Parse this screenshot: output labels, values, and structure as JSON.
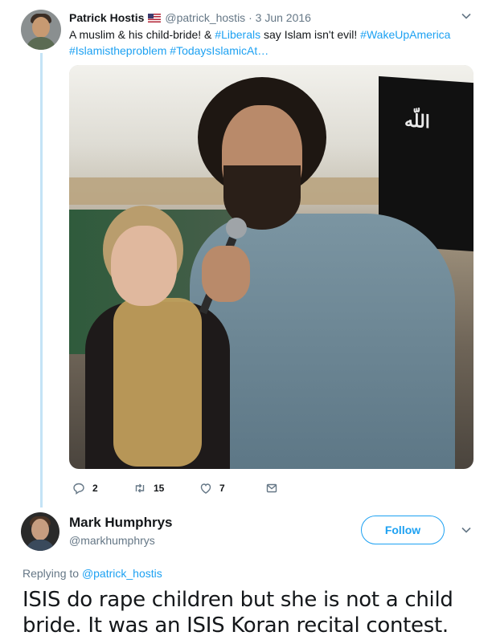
{
  "original_tweet": {
    "author_name": "Patrick Hostis",
    "author_handle": "@patrick_hostis",
    "separator": "·",
    "date": "3 Jun 2016",
    "text_parts": {
      "plain1": "A muslim & his child-bride! & ",
      "tag1": "#Liberals",
      "plain2": " say Islam isn't evil! ",
      "tag2": "#WakeUpAmerica",
      "tag3": "#Islamistheproblem",
      "tag4": "#TodaysIslamicAt…"
    },
    "photo_flag_text": "اللّه",
    "actions": {
      "reply_count": "2",
      "retweet_count": "15",
      "like_count": "7"
    }
  },
  "reply_tweet": {
    "author_name": "Mark Humphrys",
    "author_handle": "@markhumphrys",
    "follow_label": "Follow",
    "replying_label": "Replying to ",
    "replying_to": "@patrick_hostis",
    "text": "ISIS do rape children but she is not a child bride. It was an ISIS Koran recital contest."
  },
  "icons": [
    "flag-us-icon",
    "chevron-down-icon",
    "reply-icon",
    "retweet-icon",
    "like-icon",
    "direct-message-icon"
  ],
  "colors": {
    "link": "#1da1f2",
    "muted": "#657786",
    "thread_line": "#c4e3f6",
    "text": "#14171a"
  }
}
